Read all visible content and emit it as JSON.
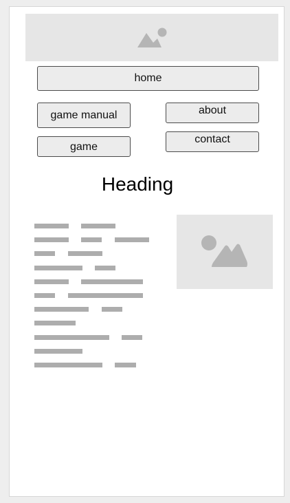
{
  "nav": {
    "home": "home",
    "game_manual": "game manual",
    "about": "about",
    "contact": "contact",
    "game": "game"
  },
  "content": {
    "heading": "Heading"
  },
  "icons": {
    "banner": "image-placeholder-icon",
    "photo": "image-placeholder-icon"
  },
  "colors": {
    "page_bg": "#eeeeee",
    "frame_bg": "#ffffff",
    "placeholder_bg": "#e6e6e6",
    "placeholder_icon": "#b5b5b5",
    "button_bg": "#ececec",
    "button_border": "#4a4a4a",
    "text_line": "#adadad"
  }
}
